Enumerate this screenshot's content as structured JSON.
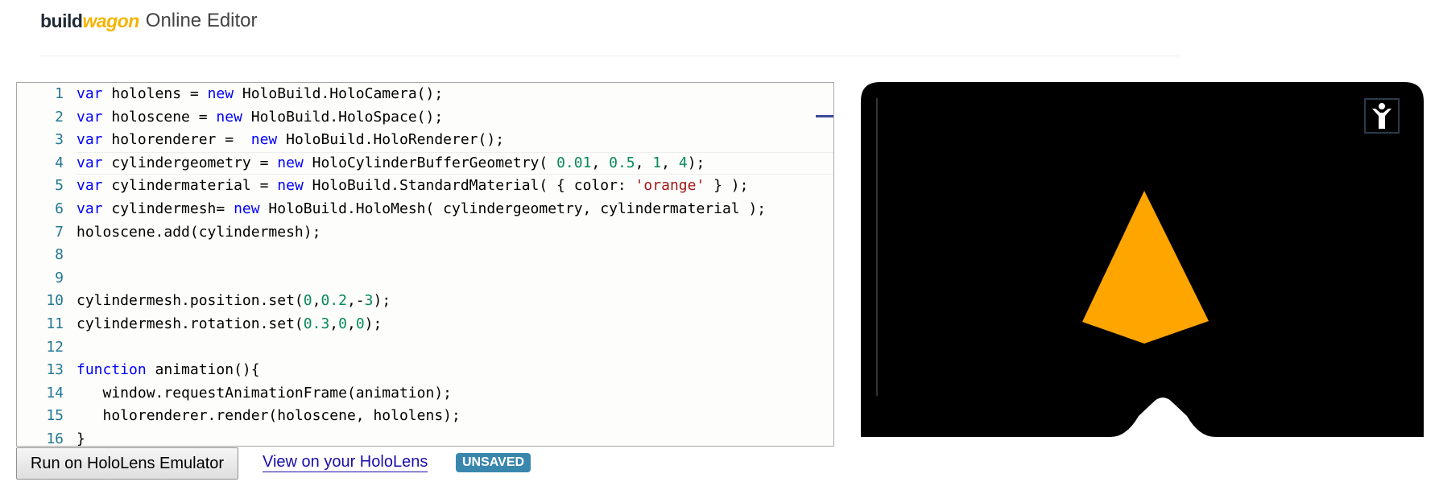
{
  "header": {
    "logo_build": "build",
    "logo_wagon": "wagon",
    "title": "Online Editor"
  },
  "editor": {
    "lines": [
      {
        "n": "1",
        "tokens": [
          {
            "t": "kw",
            "v": "var"
          },
          {
            "t": "pl",
            "v": " hololens = "
          },
          {
            "t": "kw",
            "v": "new"
          },
          {
            "t": "pl",
            "v": " HoloBuild.HoloCamera();"
          }
        ]
      },
      {
        "n": "2",
        "tokens": [
          {
            "t": "kw",
            "v": "var"
          },
          {
            "t": "pl",
            "v": " holoscene = "
          },
          {
            "t": "kw",
            "v": "new"
          },
          {
            "t": "pl",
            "v": " HoloBuild.HoloSpace();"
          }
        ]
      },
      {
        "n": "3",
        "tokens": [
          {
            "t": "kw",
            "v": "var"
          },
          {
            "t": "pl",
            "v": " holorenderer =  "
          },
          {
            "t": "kw",
            "v": "new"
          },
          {
            "t": "pl",
            "v": " HoloBuild.HoloRenderer();"
          }
        ]
      },
      {
        "n": "4",
        "current": true,
        "tokens": [
          {
            "t": "kw",
            "v": "var"
          },
          {
            "t": "pl",
            "v": " cylindergeometry = "
          },
          {
            "t": "kw",
            "v": "new"
          },
          {
            "t": "pl",
            "v": " HoloCylinderBufferGeometry( "
          },
          {
            "t": "num",
            "v": "0.01"
          },
          {
            "t": "pl",
            "v": ", "
          },
          {
            "t": "num",
            "v": "0.5"
          },
          {
            "t": "pl",
            "v": ", "
          },
          {
            "t": "num",
            "v": "1"
          },
          {
            "t": "pl",
            "v": ", "
          },
          {
            "t": "num",
            "v": "4"
          },
          {
            "t": "pl",
            "v": ");"
          }
        ]
      },
      {
        "n": "5",
        "tokens": [
          {
            "t": "kw",
            "v": "var"
          },
          {
            "t": "pl",
            "v": " cylindermaterial = "
          },
          {
            "t": "kw",
            "v": "new"
          },
          {
            "t": "pl",
            "v": " HoloBuild.StandardMaterial( { color: "
          },
          {
            "t": "str",
            "v": "'orange'"
          },
          {
            "t": "pl",
            "v": " } );"
          }
        ]
      },
      {
        "n": "6",
        "tokens": [
          {
            "t": "kw",
            "v": "var"
          },
          {
            "t": "pl",
            "v": " cylindermesh= "
          },
          {
            "t": "kw",
            "v": "new"
          },
          {
            "t": "pl",
            "v": " HoloBuild.HoloMesh( cylindergeometry, cylindermaterial );"
          }
        ]
      },
      {
        "n": "7",
        "tokens": [
          {
            "t": "pl",
            "v": "holoscene.add(cylindermesh);"
          }
        ]
      },
      {
        "n": "8",
        "tokens": []
      },
      {
        "n": "9",
        "tokens": []
      },
      {
        "n": "10",
        "tokens": [
          {
            "t": "pl",
            "v": "cylindermesh.position.set("
          },
          {
            "t": "num",
            "v": "0"
          },
          {
            "t": "pl",
            "v": ","
          },
          {
            "t": "num",
            "v": "0.2"
          },
          {
            "t": "pl",
            "v": ",-"
          },
          {
            "t": "num",
            "v": "3"
          },
          {
            "t": "pl",
            "v": ");"
          }
        ]
      },
      {
        "n": "11",
        "tokens": [
          {
            "t": "pl",
            "v": "cylindermesh.rotation.set("
          },
          {
            "t": "num",
            "v": "0.3"
          },
          {
            "t": "pl",
            "v": ","
          },
          {
            "t": "num",
            "v": "0"
          },
          {
            "t": "pl",
            "v": ","
          },
          {
            "t": "num",
            "v": "0"
          },
          {
            "t": "pl",
            "v": ");"
          }
        ]
      },
      {
        "n": "12",
        "tokens": []
      },
      {
        "n": "13",
        "tokens": [
          {
            "t": "kw",
            "v": "function"
          },
          {
            "t": "pl",
            "v": " animation(){"
          }
        ]
      },
      {
        "n": "14",
        "tokens": [
          {
            "t": "pl",
            "v": "   window.requestAnimationFrame(animation);"
          }
        ]
      },
      {
        "n": "15",
        "tokens": [
          {
            "t": "pl",
            "v": "   holorenderer.render(holoscene, hololens);"
          }
        ]
      },
      {
        "n": "16",
        "tokens": [
          {
            "t": "pl",
            "v": "}"
          }
        ]
      }
    ]
  },
  "actions": {
    "run_label": "Run on HoloLens Emulator",
    "view_link": "View on your HoloLens",
    "status_badge": "UNSAVED"
  },
  "viewer": {
    "background": "#000000",
    "object_color": "#ffa500",
    "vr_icon": "person-icon"
  },
  "colors": {
    "keyword": "#0000ff",
    "number": "#09885a",
    "string": "#a31515",
    "line_number": "#237893",
    "badge": "#3a87ad"
  }
}
